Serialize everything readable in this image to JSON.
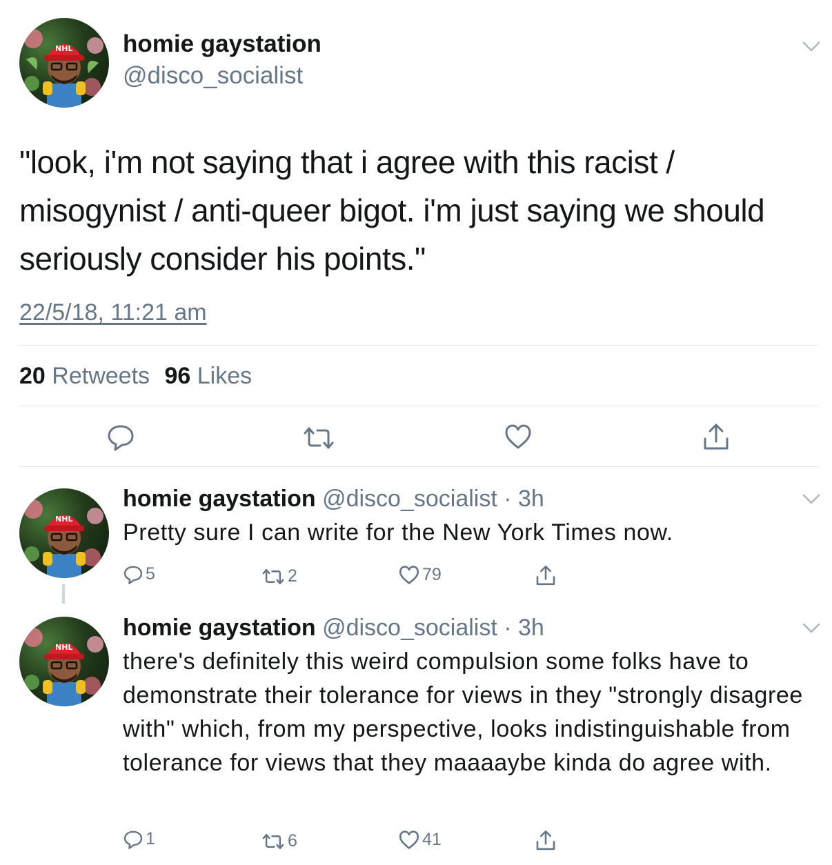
{
  "main_tweet": {
    "name": "homie gaystation",
    "handle": "@disco_socialist",
    "text": "\"look, i'm not saying that i agree with this racist / misogynist / anti-queer bigot. i'm just saying we should seriously consider his points.\"",
    "timestamp": "22/5/18, 11:21 am",
    "retweet_count": "20",
    "retweet_label": "Retweets",
    "like_count": "96",
    "like_label": "Likes",
    "actions": [
      "reply-icon",
      "retweet-icon",
      "like-icon",
      "share-icon"
    ]
  },
  "replies": [
    {
      "name": "homie gaystation",
      "handle": "@disco_socialist",
      "time": "· 3h",
      "text": "Pretty sure I can write for the New York Times now.",
      "reply_count": "5",
      "retweet_count": "2",
      "like_count": "79"
    },
    {
      "name": "homie gaystation",
      "handle": "@disco_socialist",
      "time": "· 3h",
      "text": "there's definitely this weird compulsion some folks have to demonstrate their tolerance for views in they \"strongly disagree with\" which, from my perspective, looks indistinguishable from tolerance for views that they maaaaybe kinda do agree with.",
      "reply_count": "1",
      "retweet_count": "6",
      "like_count": "41"
    }
  ],
  "colors": {
    "text": "#14171a",
    "secondary": "#657786",
    "divider": "#e1e8ed",
    "icon": "#657786"
  }
}
